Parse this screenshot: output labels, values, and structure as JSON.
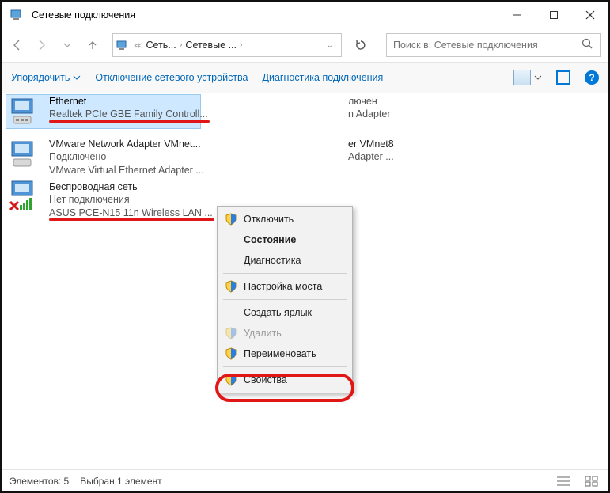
{
  "titlebar": {
    "title": "Сетевые подключения"
  },
  "breadcrumb": {
    "part1": "Сеть...",
    "part2": "Сетевые ..."
  },
  "search": {
    "placeholder": "Поиск в: Сетевые подключения"
  },
  "toolbar": {
    "organize": "Упорядочить",
    "disable": "Отключение сетевого устройства",
    "diagnose": "Диагностика подключения"
  },
  "items": [
    {
      "name": "Ethernet",
      "line2": "",
      "line3": "Realtek PCIe GBE Family Controll..."
    },
    {
      "name": "VMware Network Adapter VMnet...",
      "line2": "Подключено",
      "line3": "VMware Virtual Ethernet Adapter ..."
    },
    {
      "name": "Беспроводная сеть",
      "line2": "Нет подключения",
      "line3": "ASUS PCE-N15 11n Wireless LAN ..."
    },
    {
      "name": "",
      "line2": "лючен",
      "line3": "n Adapter"
    },
    {
      "name": "er VMnet8",
      "line2": "",
      "line3": "Adapter ..."
    }
  ],
  "context_menu": {
    "disconnect": "Отключить",
    "status": "Состояние",
    "diagnostics": "Диагностика",
    "bridge": "Настройка моста",
    "shortcut": "Создать ярлык",
    "delete": "Удалить",
    "rename": "Переименовать",
    "properties": "Свойства"
  },
  "statusbar": {
    "count": "Элементов: 5",
    "selected": "Выбран 1 элемент"
  }
}
